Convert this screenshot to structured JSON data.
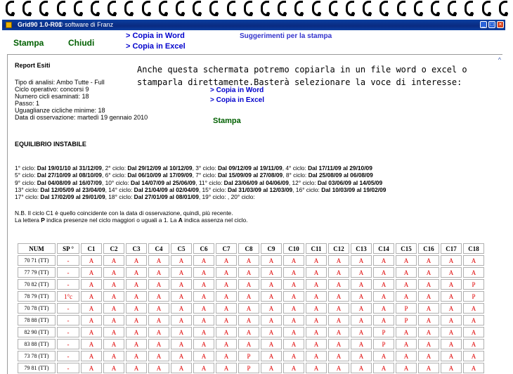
{
  "window": {
    "title": "Grid90 1.0-R01",
    "subtitle": "© software di Franz",
    "controls": [
      "_",
      "□",
      "×"
    ]
  },
  "toolbar": {
    "stampa": "Stampa",
    "chiudi": "Chiudi",
    "copia_word": "> Copia in Word",
    "copia_excel": "> Copia in Excel",
    "suggerimenti": "Suggerimenti per la stampa"
  },
  "report": {
    "title": "Report Esiti",
    "info_lines": [
      "Tipo di analisi: Ambo Tutte - Full",
      "Ciclo operativo: concorsi 9",
      "Numero cicli esaminati: 18",
      "Passo: 1",
      "Uguaglianze cicliche minime: 18",
      "Data di osservazione: martedì 19 gennaio 2010"
    ],
    "note_lines": [
      "Anche questa schermata potremo copiarla in un file word o excel o",
      "stamparla direttamente.Basterà selezionare la voce di interesse:"
    ],
    "copia_word": "> Copia in Word",
    "copia_excel": "> Copia in Excel",
    "stampa": "Stampa",
    "section_title": "EQUILIBRIO INSTABILE",
    "cycle_lines": [
      [
        [
          "1° ciclo: ",
          false
        ],
        [
          "Dal 19/01/10 al 31/12/09",
          true
        ],
        [
          ", 2° ciclo: ",
          false
        ],
        [
          "Dal 29/12/09 al 10/12/09",
          true
        ],
        [
          ", 3° ciclo: ",
          false
        ],
        [
          "Dal 09/12/09 al 19/11/09",
          true
        ],
        [
          ", 4° ciclo: ",
          false
        ],
        [
          "Dal 17/11/09 al 29/10/09",
          true
        ]
      ],
      [
        [
          "5° ciclo: ",
          false
        ],
        [
          "Dal 27/10/09 al 08/10/09",
          true
        ],
        [
          ", 6° ciclo: ",
          false
        ],
        [
          "Dal 06/10/09 al 17/09/09",
          true
        ],
        [
          ", 7° ciclo: ",
          false
        ],
        [
          "Dal 15/09/09 al 27/08/09",
          true
        ],
        [
          ", 8° ciclo: ",
          false
        ],
        [
          "Dal 25/08/09 al 06/08/09",
          true
        ]
      ],
      [
        [
          "9° ciclo: ",
          false
        ],
        [
          "Dal 04/08/09 al 16/07/09",
          true
        ],
        [
          ", 10° ciclo: ",
          false
        ],
        [
          "Dal 14/07/09 al 25/06/09",
          true
        ],
        [
          ", 11° ciclo: ",
          false
        ],
        [
          "Dal 23/06/09 al 04/06/09",
          true
        ],
        [
          ", 12° ciclo: ",
          false
        ],
        [
          "Dal 03/06/09 al 14/05/09",
          true
        ]
      ],
      [
        [
          "13° ciclo: ",
          false
        ],
        [
          "Dal 12/05/09 al 23/04/09",
          true
        ],
        [
          ", 14° ciclo: ",
          false
        ],
        [
          "Dal 21/04/09 al 02/04/09",
          true
        ],
        [
          ", 15° ciclo: ",
          false
        ],
        [
          "Dal 31/03/09 al 12/03/09",
          true
        ],
        [
          ", 16° ciclo: ",
          false
        ],
        [
          "Dal 10/03/09 al 19/02/09",
          true
        ]
      ],
      [
        [
          "17° ciclo: ",
          false
        ],
        [
          "Dal 17/02/09 al 29/01/09",
          true
        ],
        [
          ", 18° ciclo: ",
          false
        ],
        [
          "Dal 27/01/09 al 08/01/09",
          true
        ],
        [
          ", 19° ciclo: , 20° ciclo:",
          false
        ]
      ]
    ],
    "nb_lines": [
      [
        [
          "N.B. Il ciclo C1 è quello coincidente con la data di osservazione, quindi, più recente.",
          false
        ]
      ],
      [
        [
          "La lettera ",
          false
        ],
        [
          "P",
          true
        ],
        [
          " indica presenze nel ciclo maggiori o uguali a 1. La ",
          false
        ],
        [
          "A",
          true
        ],
        [
          " indica assenza nel ciclo.",
          false
        ]
      ]
    ]
  },
  "table": {
    "headers": [
      "NUM",
      "SP °",
      "C1",
      "C2",
      "C3",
      "C4",
      "C5",
      "C6",
      "C7",
      "C8",
      "C9",
      "C10",
      "C11",
      "C12",
      "C13",
      "C14",
      "C15",
      "C16",
      "C17",
      "C18"
    ],
    "rows": [
      [
        "70 71 (TT)",
        "-",
        "A",
        "A",
        "A",
        "A",
        "A",
        "A",
        "A",
        "A",
        "A",
        "A",
        "A",
        "A",
        "A",
        "A",
        "A",
        "A",
        "A",
        "A"
      ],
      [
        "77 79 (TT)",
        "-",
        "A",
        "A",
        "A",
        "A",
        "A",
        "A",
        "A",
        "A",
        "A",
        "A",
        "A",
        "A",
        "A",
        "A",
        "A",
        "A",
        "A",
        "A"
      ],
      [
        "70 82 (TT)",
        "-",
        "A",
        "A",
        "A",
        "A",
        "A",
        "A",
        "A",
        "A",
        "A",
        "A",
        "A",
        "A",
        "A",
        "A",
        "A",
        "A",
        "A",
        "P"
      ],
      [
        "78 79 (TT)",
        "1°c",
        "A",
        "A",
        "A",
        "A",
        "A",
        "A",
        "A",
        "A",
        "A",
        "A",
        "A",
        "A",
        "A",
        "A",
        "A",
        "A",
        "A",
        "P"
      ],
      [
        "70 78 (TT)",
        "-",
        "A",
        "A",
        "A",
        "A",
        "A",
        "A",
        "A",
        "A",
        "A",
        "A",
        "A",
        "A",
        "A",
        "A",
        "P",
        "A",
        "A",
        "A"
      ],
      [
        "78 88 (TT)",
        "-",
        "A",
        "A",
        "A",
        "A",
        "A",
        "A",
        "A",
        "A",
        "A",
        "A",
        "A",
        "A",
        "A",
        "A",
        "P",
        "A",
        "A",
        "A"
      ],
      [
        "82 90 (TT)",
        "-",
        "A",
        "A",
        "A",
        "A",
        "A",
        "A",
        "A",
        "A",
        "A",
        "A",
        "A",
        "A",
        "A",
        "P",
        "A",
        "A",
        "A",
        "A"
      ],
      [
        "83 88 (TT)",
        "-",
        "A",
        "A",
        "A",
        "A",
        "A",
        "A",
        "A",
        "A",
        "A",
        "A",
        "A",
        "A",
        "A",
        "P",
        "A",
        "A",
        "A",
        "A"
      ],
      [
        "73 78 (TT)",
        "-",
        "A",
        "A",
        "A",
        "A",
        "A",
        "A",
        "A",
        "P",
        "A",
        "A",
        "A",
        "A",
        "A",
        "A",
        "A",
        "A",
        "A",
        "A"
      ],
      [
        "79 81 (TT)",
        "-",
        "A",
        "A",
        "A",
        "A",
        "A",
        "A",
        "A",
        "P",
        "A",
        "A",
        "A",
        "A",
        "A",
        "A",
        "A",
        "A",
        "A",
        "A"
      ]
    ]
  },
  "colors": {
    "titlebar": "#0a2a80",
    "link": "#0000cc",
    "action": "#006000",
    "cell_value": "#e00000"
  }
}
